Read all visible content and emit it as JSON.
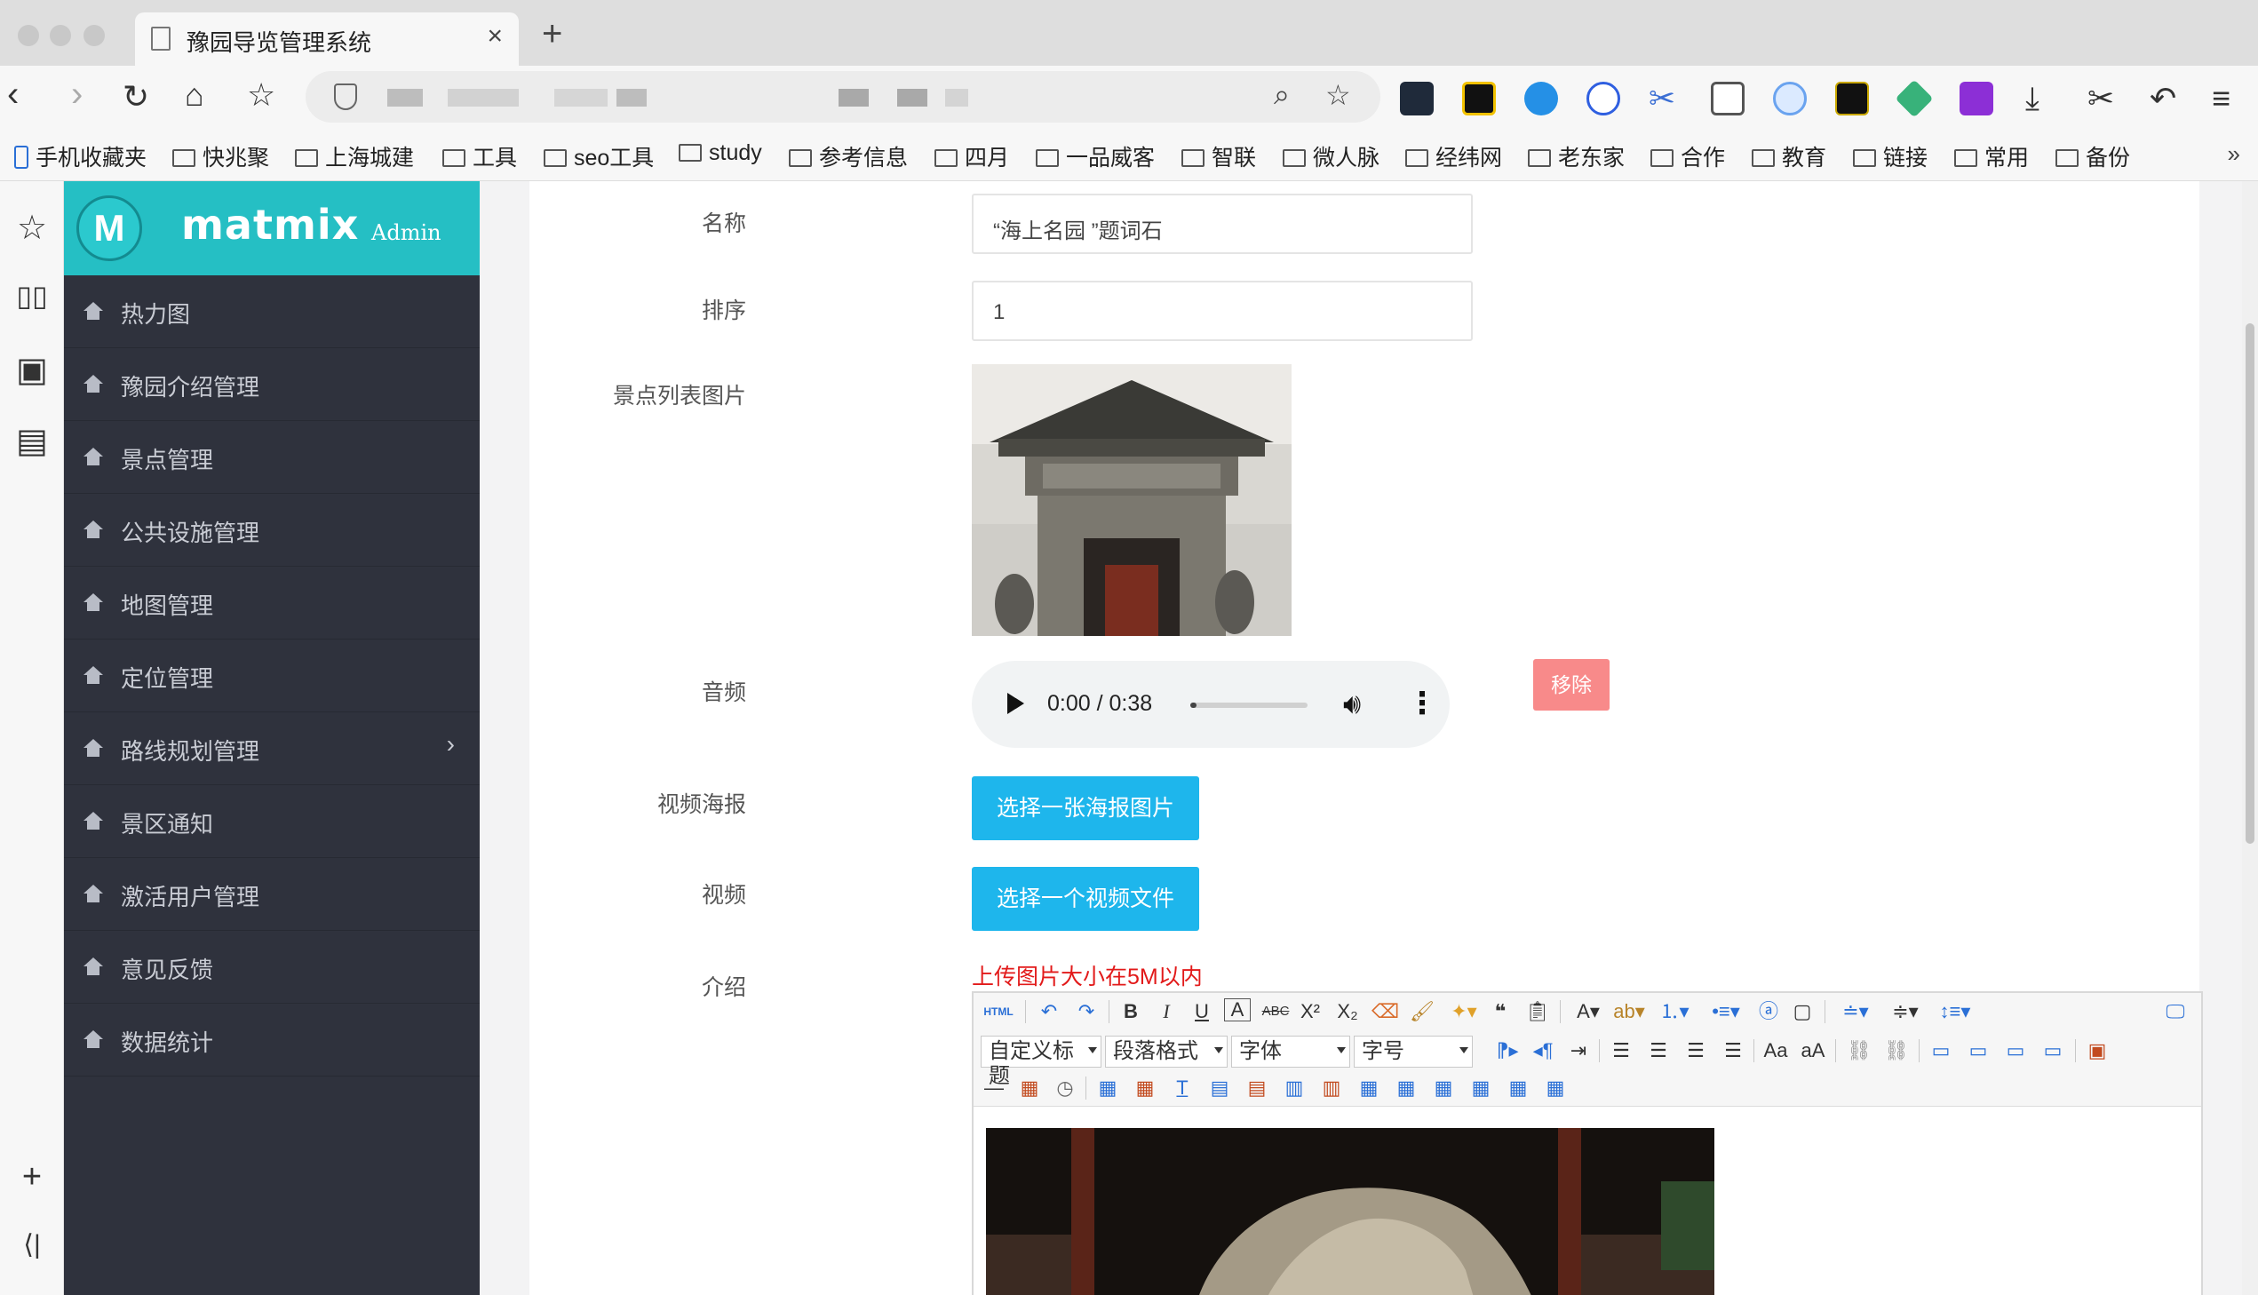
{
  "browser": {
    "tab_title": "豫园导览管理系统",
    "tab_close": "×",
    "new_tab": "+",
    "url_partial": "",
    "bookmarks": [
      {
        "label": "手机收藏夹",
        "icon": "mobile-icon"
      },
      {
        "label": "快兆聚",
        "icon": "folder-icon"
      },
      {
        "label": "上海城建",
        "icon": "folder-icon"
      },
      {
        "label": "工具",
        "icon": "folder-icon"
      },
      {
        "label": "seo工具",
        "icon": "folder-icon"
      },
      {
        "label": "study",
        "icon": "folder-icon"
      },
      {
        "label": "参考信息",
        "icon": "folder-icon"
      },
      {
        "label": "四月",
        "icon": "folder-icon"
      },
      {
        "label": "一品威客",
        "icon": "folder-icon"
      },
      {
        "label": "智联",
        "icon": "folder-icon"
      },
      {
        "label": "微人脉",
        "icon": "folder-icon"
      },
      {
        "label": "经纬网",
        "icon": "folder-icon"
      },
      {
        "label": "老东家",
        "icon": "folder-icon"
      },
      {
        "label": "合作",
        "icon": "folder-icon"
      },
      {
        "label": "教育",
        "icon": "folder-icon"
      },
      {
        "label": "链接",
        "icon": "folder-icon"
      },
      {
        "label": "常用",
        "icon": "folder-icon"
      },
      {
        "label": "备份",
        "icon": "folder-icon"
      }
    ],
    "bookmarks_more": "»"
  },
  "brand": {
    "logo_letter": "M",
    "name": "matmix",
    "sub": "Admin",
    "color": "#25bfc4"
  },
  "sidebar": {
    "items": [
      {
        "label": "热力图"
      },
      {
        "label": "豫园介绍管理"
      },
      {
        "label": "景点管理"
      },
      {
        "label": "公共设施管理"
      },
      {
        "label": "地图管理"
      },
      {
        "label": "定位管理"
      },
      {
        "label": "路线规划管理",
        "arrow": "›"
      },
      {
        "label": "景区通知"
      },
      {
        "label": "激活用户管理"
      },
      {
        "label": "意见反馈"
      },
      {
        "label": "数据统计"
      }
    ]
  },
  "form": {
    "name_label": "名称",
    "name_value": "“海上名园 ”题词石",
    "sort_label": "排序",
    "sort_value": "1",
    "image_label": "景点列表图片",
    "audio_label": "音频",
    "audio_time": "0:00 / 0:38",
    "audio_progress": 0.05,
    "remove_label": "移除",
    "poster_label": "视频海报",
    "poster_button": "选择一张海报图片",
    "video_label": "视频",
    "video_button": "选择一个视频文件",
    "intro_label": "介绍",
    "upload_note": "上传图片大小在5M以内"
  },
  "editor": {
    "html_btn": "HTML",
    "custom_title": "自定义标题",
    "paragraph_format": "段落格式",
    "font_family": "字体",
    "font_size": "字号"
  },
  "colors": {
    "sidebar_bg": "#2f323d",
    "accent": "#25bfc4",
    "button_blue": "#1eb6ec",
    "button_remove": "#f88a8a",
    "note_red": "#e21a1a"
  }
}
